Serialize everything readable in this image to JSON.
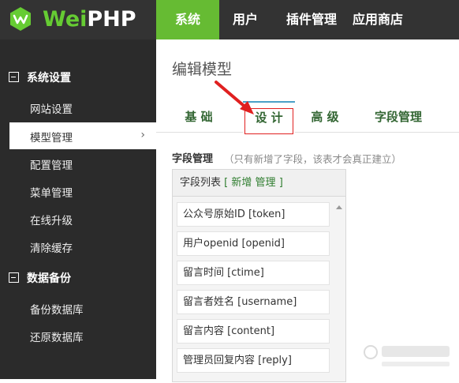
{
  "brand": {
    "name_part1": "Wei",
    "name_part2": "PHP",
    "accent": "#66bb33"
  },
  "topnav": [
    {
      "label": "系统",
      "active": true
    },
    {
      "label": "用户"
    },
    {
      "label": "插件管理"
    },
    {
      "label": "应用商店"
    }
  ],
  "sidebar": {
    "sections": [
      {
        "title": "系统设置",
        "items": [
          "网站设置",
          "模型管理",
          "配置管理",
          "菜单管理",
          "在线升级",
          "清除缓存"
        ]
      },
      {
        "title": "数据备份",
        "items": [
          "备份数据库",
          "还原数据库"
        ]
      }
    ],
    "active_item": "模型管理"
  },
  "page": {
    "title": "编辑模型"
  },
  "tabs": [
    "基 础",
    "设 计",
    "高 级",
    "字段管理"
  ],
  "active_tab": "设 计",
  "fields": {
    "title": "字段管理",
    "note": "（只有新增了字段，该表才会真正建立）",
    "panel_title": "字段列表",
    "bracket_open": "[",
    "add_link": "新增",
    "manage_link": "管理",
    "bracket_close": "]",
    "rows": [
      "公众号原始ID [token]",
      "用户openid [openid]",
      "留言时间 [ctime]",
      "留言者姓名 [username]",
      "留言内容 [content]",
      "管理员回复内容 [reply]"
    ]
  },
  "icons": {
    "logo": "weiphp-badge-icon",
    "section_toggle": "collapse-box-icon",
    "chevron": "chevron-right-icon",
    "scroll_up": "scroll-up-arrow-icon"
  }
}
